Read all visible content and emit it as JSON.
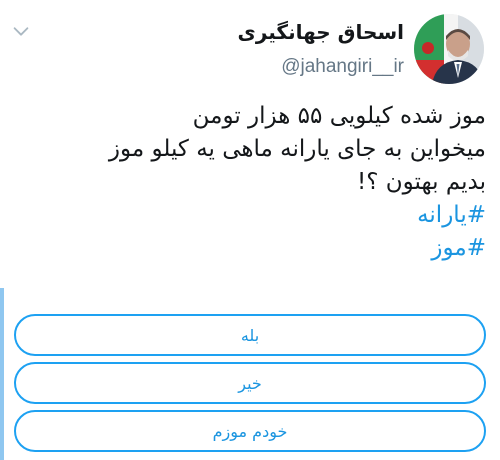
{
  "tweet": {
    "author": {
      "display_name": "اسحاق جهانگیری",
      "handle": "@jahangiri__ir"
    },
    "text_lines": [
      "موز شده کیلویی ۵۵ هزار تومن",
      "میخواین به جای یارانه ماهی یه کیلو موز",
      "بدیم بهتون ؟!"
    ],
    "hashtags": [
      "#یارانه",
      "#موز"
    ]
  },
  "poll": {
    "options": [
      {
        "label": "بله"
      },
      {
        "label": "خیر"
      },
      {
        "label": "خودم موزم"
      }
    ]
  },
  "colors": {
    "link": "#1b95e0",
    "poll_border": "#1da1f2",
    "handle": "#657786",
    "text": "#14171a"
  },
  "icons": {
    "menu": "chevron-down-icon",
    "avatar": "avatar"
  }
}
